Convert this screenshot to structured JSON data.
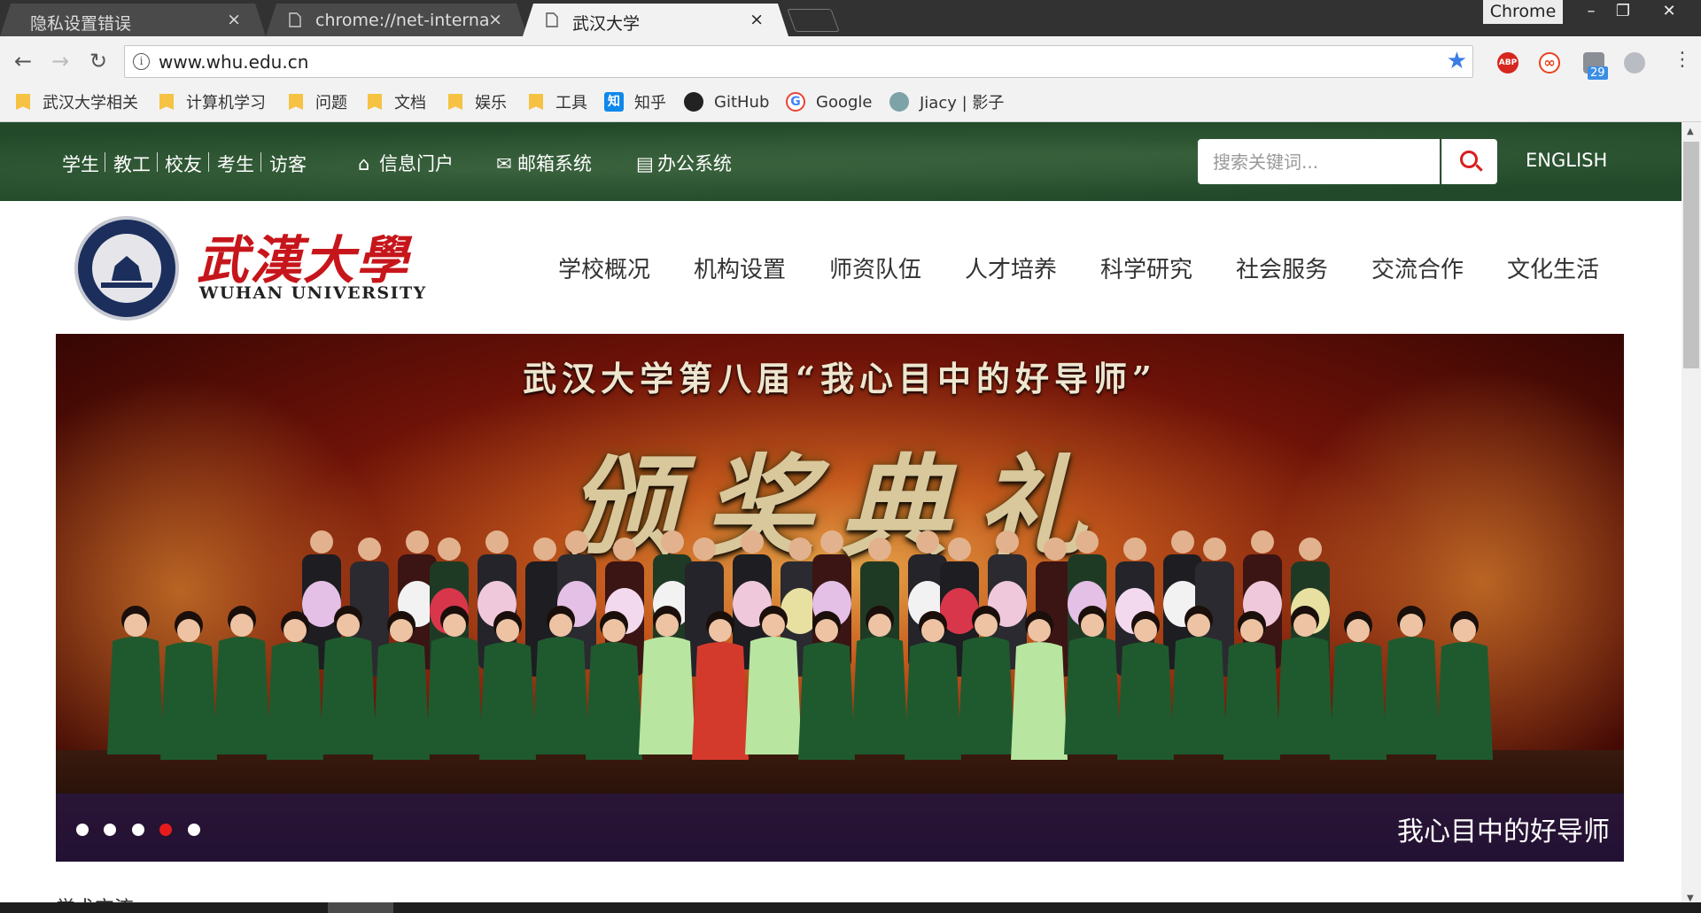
{
  "browser": {
    "tabs": [
      {
        "title": "隐私设置错误",
        "close": "×"
      },
      {
        "title": "chrome://net-internals",
        "close": "×"
      },
      {
        "title": "武汉大学",
        "close": "×"
      }
    ],
    "profile_label": "Chrome",
    "window_buttons": {
      "minimize": "–",
      "restore": "❐",
      "close": "✕"
    },
    "nav": {
      "back": "←",
      "forward": "→",
      "reload": "↻"
    },
    "address": {
      "info": "i",
      "url": "www.whu.edu.cn",
      "star": "★"
    },
    "extensions": [
      {
        "name": "adblock-plus-icon",
        "text": "ABP",
        "color": "#d7261e"
      },
      {
        "name": "infinity-icon",
        "text": "∞",
        "color": "#e8421e"
      },
      {
        "name": "pin-icon",
        "text": "",
        "color": "#8a8f96"
      },
      {
        "name": "circle-icon",
        "text": "",
        "color": "#b9bcc2"
      }
    ],
    "extension_badge": "29",
    "menu": "⋮",
    "bookmarks": [
      {
        "label": "武汉大学相关",
        "type": "folder"
      },
      {
        "label": "计算机学习",
        "type": "folder"
      },
      {
        "label": "问题",
        "type": "folder"
      },
      {
        "label": "文档",
        "type": "folder"
      },
      {
        "label": "娱乐",
        "type": "folder"
      },
      {
        "label": "工具",
        "type": "folder"
      },
      {
        "label": "知乎",
        "type": "site",
        "glyph": "知",
        "color": "#0f88eb"
      },
      {
        "label": "GitHub",
        "type": "site",
        "glyph": "",
        "color": "#222"
      },
      {
        "label": "Google",
        "type": "site",
        "glyph": "G",
        "color": "#4285f4"
      },
      {
        "label": "Jiacy | 影子",
        "type": "site",
        "glyph": "",
        "color": "#7da3a8"
      }
    ]
  },
  "site": {
    "audience": [
      "学生",
      "教工",
      "校友",
      "考生",
      "访客"
    ],
    "top_links": [
      {
        "icon": "home-icon",
        "glyph": "⌂",
        "label": "信息门户"
      },
      {
        "icon": "mail-icon",
        "glyph": "✉",
        "label": "邮箱系统"
      },
      {
        "icon": "office-icon",
        "glyph": "▤",
        "label": "办公系统"
      }
    ],
    "search_placeholder": "搜索关键词...",
    "english": "ENGLISH",
    "logo_cn": "武漢大學",
    "logo_en": "WUHAN UNIVERSITY",
    "main_nav": [
      "学校概况",
      "机构设置",
      "师资队伍",
      "人才培养",
      "科学研究",
      "社会服务",
      "交流合作",
      "文化生活"
    ],
    "banner": {
      "title": "武汉大学第八届“我心目中的好导师”",
      "headline": "颁奖典礼",
      "caption": "我心目中的好导师",
      "slides": 5,
      "active_slide": 4
    },
    "below_fold_text": "学术交流"
  },
  "colors": {
    "topbar": "#224a2a",
    "logo_red": "#c6161b",
    "active_dot": "#e61c1c"
  }
}
